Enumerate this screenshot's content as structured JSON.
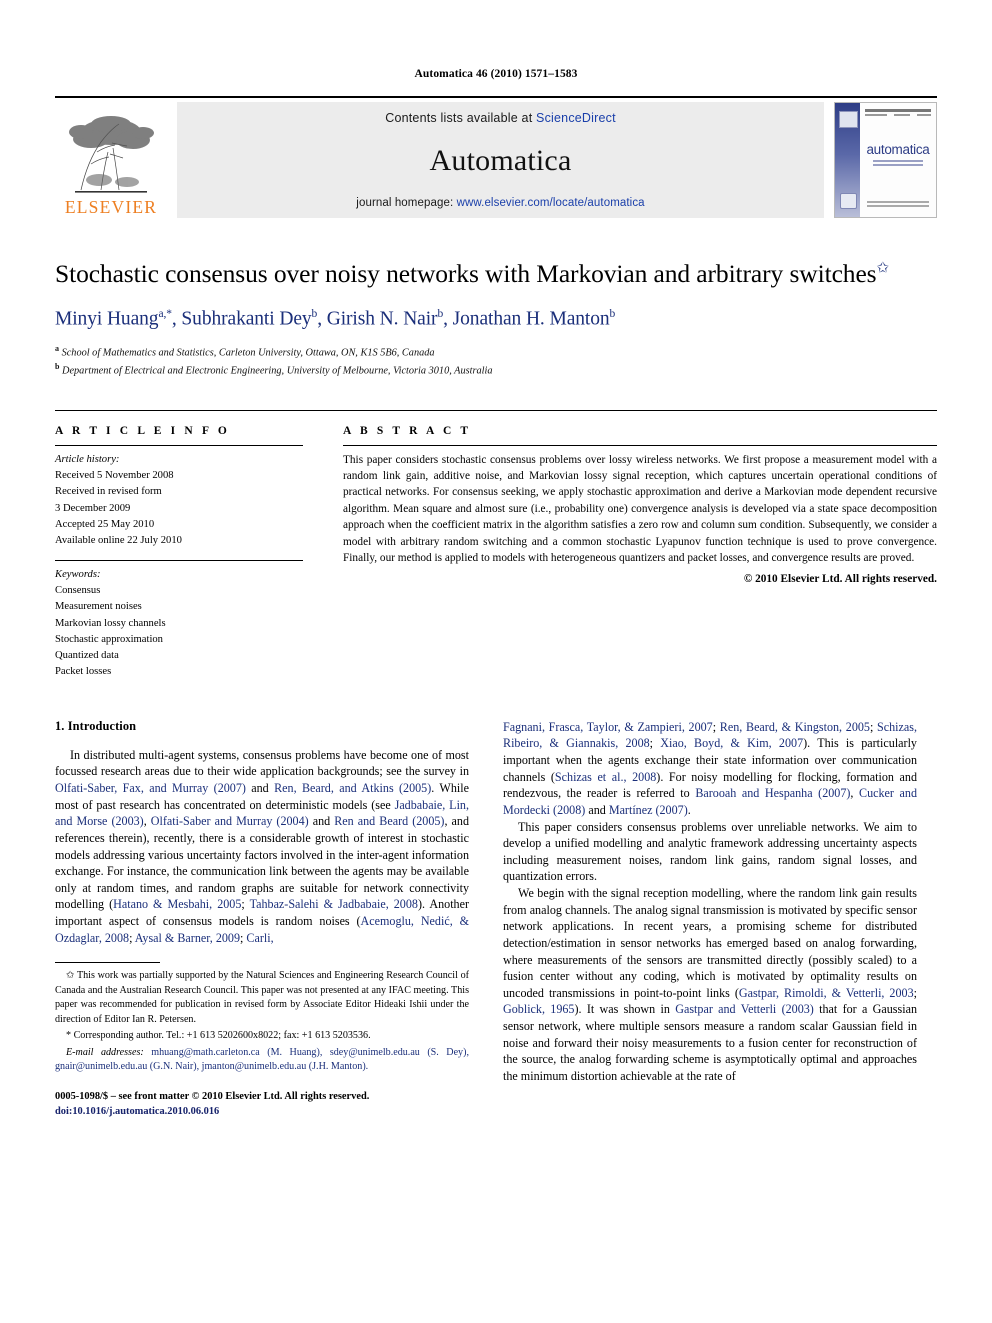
{
  "running_head": "Automatica 46 (2010) 1571–1583",
  "masthead": {
    "publisher_name": "ELSEVIER",
    "contents_prefix": "Contents lists available at ",
    "contents_link": "ScienceDirect",
    "journal_title": "Automatica",
    "homepage_prefix": "journal homepage: ",
    "homepage_url": "www.elsevier.com/locate/automatica",
    "cover_word": "automatica",
    "link_color": "#1a3faa"
  },
  "article": {
    "title": "Stochastic consensus over noisy networks with Markovian and arbitrary switches",
    "title_footnote_marker": "✩",
    "authors": "Minyi Huang a,*, Subhrakanti Dey b, Girish N. Nair b, Jonathan H. Manton b",
    "author_color": "#1b2f7a",
    "affiliations": [
      {
        "marker": "a",
        "text": "School of Mathematics and Statistics, Carleton University, Ottawa, ON, K1S 5B6, Canada"
      },
      {
        "marker": "b",
        "text": "Department of Electrical and Electronic Engineering, University of Melbourne, Victoria 3010, Australia"
      }
    ]
  },
  "info": {
    "heading": "A R T I C L E    I N F O",
    "history_label": "Article history:",
    "history": [
      "Received 5 November 2008",
      "Received in revised form",
      "3 December 2009",
      "Accepted 25 May 2010",
      "Available online 22 July 2010"
    ],
    "keywords_label": "Keywords:",
    "keywords": [
      "Consensus",
      "Measurement noises",
      "Markovian lossy channels",
      "Stochastic approximation",
      "Quantized data",
      "Packet losses"
    ]
  },
  "abstract": {
    "heading": "A B S T R A C T",
    "text": "This paper considers stochastic consensus problems over lossy wireless networks. We first propose a measurement model with a random link gain, additive noise, and Markovian lossy signal reception, which captures uncertain operational conditions of practical networks. For consensus seeking, we apply stochastic approximation and derive a Markovian mode dependent recursive algorithm. Mean square and almost sure (i.e., probability one) convergence analysis is developed via a state space decomposition approach when the coefficient matrix in the algorithm satisfies a zero row and column sum condition. Subsequently, we consider a model with arbitrary random switching and a common stochastic Lyapunov function technique is used to prove convergence. Finally, our method is applied to models with heterogeneous quantizers and packet losses, and convergence results are proved.",
    "copyright": "© 2010 Elsevier Ltd. All rights reserved."
  },
  "section": {
    "heading": "1. Introduction",
    "left_paragraphs": [
      "In distributed multi-agent systems, consensus problems have become one of most focussed research areas due to their wide application backgrounds; see the survey in <c>Olfati-Saber, Fax, and Murray (2007)</c> and <c>Ren, Beard, and Atkins (2005)</c>. While most of past research has concentrated on deterministic models (see <c>Jadbabaie, Lin, and Morse (2003)</c>, <c>Olfati-Saber and Murray (2004)</c> and <c>Ren and Beard (2005)</c>, and references therein), recently, there is a considerable growth of interest in stochastic models addressing various uncertainty factors involved in the inter-agent information exchange. For instance, the communication link between the agents may be available only at random times, and random graphs are suitable for network connectivity modelling (<c>Hatano &amp; Mesbahi, 2005</c>; <c>Tahbaz-Salehi &amp; Jadbabaie, 2008</c>). Another important aspect of consensus models is random noises (<c>Acemoglu, Nedić, &amp; Ozdaglar, 2008</c>; <c>Aysal &amp; Barner, 2009</c>; <c>Carli,</c>"
    ],
    "right_paragraphs": [
      "<c>Fagnani, Frasca, Taylor, &amp; Zampieri, 2007</c>; <c>Ren, Beard, &amp; Kingston, 2005</c>; <c>Schizas, Ribeiro, &amp; Giannakis, 2008</c>; <c>Xiao, Boyd, &amp; Kim, 2007</c>). This is particularly important when the agents exchange their state information over communication channels (<c>Schizas et al., 2008</c>). For noisy modelling for flocking, formation and rendezvous, the reader is referred to <c>Barooah and Hespanha (2007)</c>, <c>Cucker and Mordecki (2008)</c> and <c>Martínez (2007)</c>.",
      "This paper considers consensus problems over unreliable networks. We aim to develop a unified modelling and analytic framework addressing uncertainty aspects including measurement noises, random link gains, random signal losses, and quantization errors.",
      "We begin with the signal reception modelling, where the random link gain results from analog channels. The analog signal transmission is motivated by specific sensor network applications. In recent years, a promising scheme for distributed detection/estimation in sensor networks has emerged based on analog forwarding, where measurements of the sensors are transmitted directly (possibly scaled) to a fusion center without any coding, which is motivated by optimality results on uncoded transmissions in point-to-point links (<c>Gastpar, Rimoldi, &amp; Vetterli, 2003</c>; <c>Goblick, 1965</c>). It was shown in <c>Gastpar and Vetterli (2003)</c> that for a Gaussian sensor network, where multiple sensors measure a random scalar Gaussian field in noise and forward their noisy measurements to a fusion center for reconstruction of the source, the analog forwarding scheme is asymptotically optimal and approaches the minimum distortion achievable at the rate of"
    ]
  },
  "footnotes": {
    "funding": "✩ This work was partially supported by the Natural Sciences and Engineering Research Council of Canada and the Australian Research Council. This paper was not presented at any IFAC meeting. This paper was recommended for publication in revised form by Associate Editor Hideaki Ishii under the direction of Editor Ian R. Petersen.",
    "corresponding": "* Corresponding author. Tel.: +1 613 5202600x8022; fax: +1 613 5203536.",
    "email_label": "E-mail addresses:",
    "emails": "mhuang@math.carleton.ca (M. Huang), sdey@unimelb.edu.au (S. Dey), gnair@unimelb.edu.au (G.N. Nair), jmanton@unimelb.edu.au (J.H. Manton).",
    "frontmatter": "0005-1098/$ – see front matter © 2010 Elsevier Ltd. All rights reserved.",
    "doi": "doi:10.1016/j.automatica.2010.06.016"
  }
}
